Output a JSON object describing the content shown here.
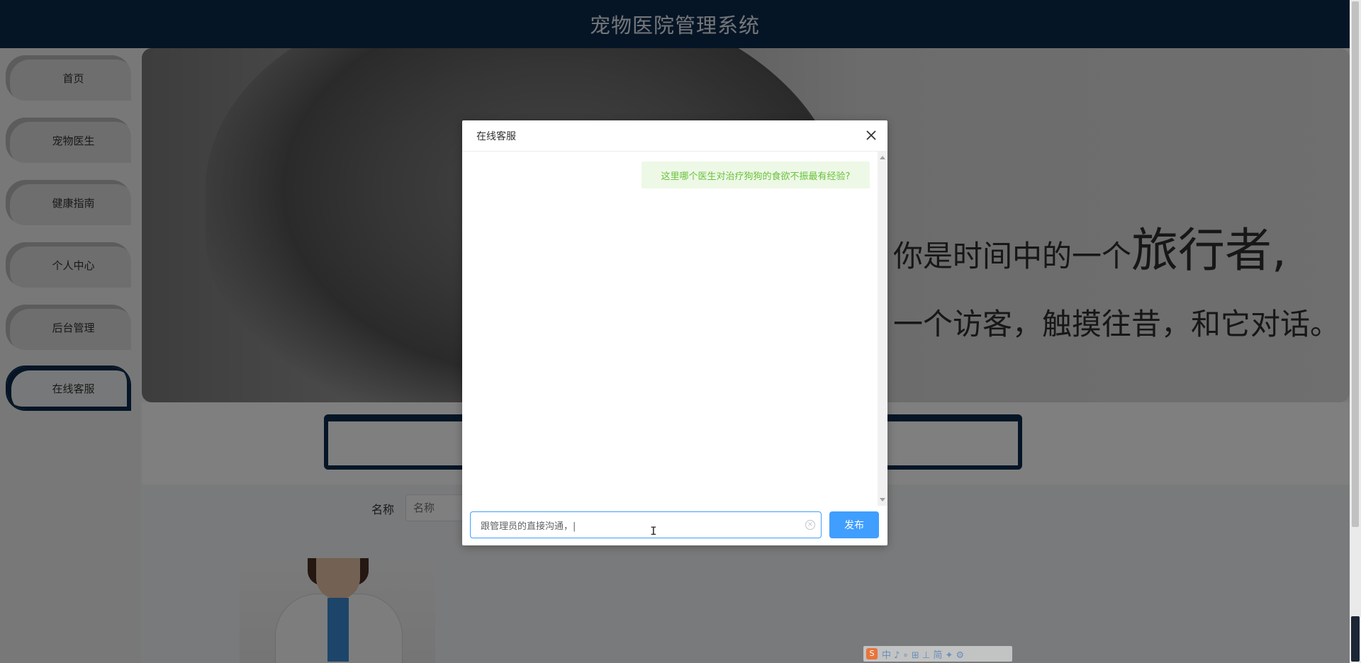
{
  "header": {
    "title": "宠物医院管理系统"
  },
  "sidebar": {
    "items": [
      {
        "label": "首页",
        "active": false
      },
      {
        "label": "宠物医生",
        "active": false
      },
      {
        "label": "健康指南",
        "active": false
      },
      {
        "label": "个人中心",
        "active": false
      },
      {
        "label": "后台管理",
        "active": false
      },
      {
        "label": "在线客服",
        "active": true
      }
    ]
  },
  "banner": {
    "line1_prefix": "你是时间中的一个",
    "line1_big": "旅行者,",
    "line2": "一个访客，触摸往昔，和它对话。"
  },
  "filter": {
    "label": "名称",
    "placeholder": "名称"
  },
  "dialog": {
    "title": "在线客服",
    "close_icon": "close-icon",
    "messages": [
      {
        "from": "user",
        "text": "这里哪个医生对治疗狗狗的食欲不振最有经验?"
      }
    ],
    "input_value": "跟管理员的直接沟通，|",
    "send_label": "发布"
  },
  "ime": {
    "logo": "S",
    "text": "中 ♪ ∘ ⊞ ⊥ 简 ✦ ⚙"
  },
  "colors": {
    "primary_navy": "#0b2b4d",
    "accent_blue": "#409eff",
    "success_green": "#67c23a"
  }
}
